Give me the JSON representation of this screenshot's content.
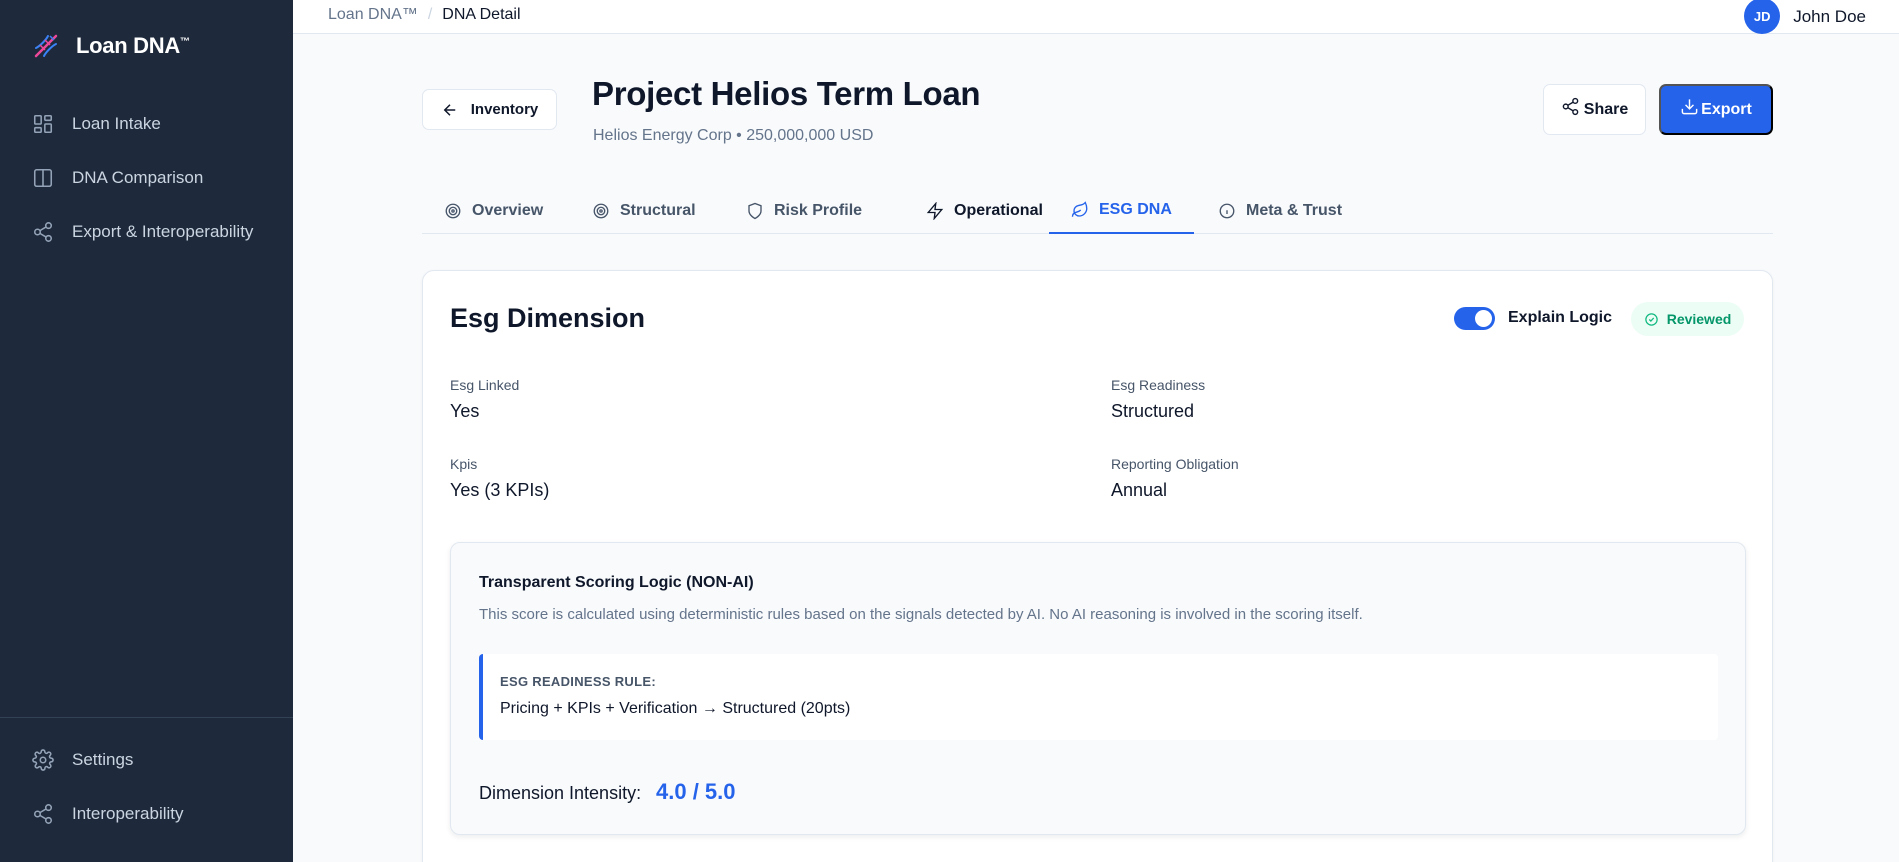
{
  "brand": {
    "name": "Loan DNA",
    "mark": "™"
  },
  "sidebar": {
    "items": [
      {
        "label": "Loan Intake",
        "icon": "grid-icon"
      },
      {
        "label": "DNA Comparison",
        "icon": "columns-icon"
      },
      {
        "label": "Export & Interoperability",
        "icon": "share-nodes-icon"
      }
    ],
    "bottom_items": [
      {
        "label": "Settings",
        "icon": "gear-icon"
      },
      {
        "label": "Interoperability",
        "icon": "share-nodes-icon"
      }
    ]
  },
  "topbar": {
    "breadcrumb": {
      "root": "Loan DNA™",
      "separator": "/",
      "current": "DNA Detail"
    },
    "user": {
      "initials": "JD",
      "name": "John Doe"
    }
  },
  "header": {
    "back_label": "Inventory",
    "title": "Project Helios Term Loan",
    "subtitle": "Helios Energy Corp • 250,000,000 USD",
    "share_label": "Share",
    "export_label": "Export"
  },
  "tabs": [
    {
      "label": "Overview",
      "icon": "target-icon"
    },
    {
      "label": "Structural",
      "icon": "target-icon"
    },
    {
      "label": "Risk Profile",
      "icon": "shield-icon"
    },
    {
      "label": "Operational",
      "icon": "lightning-icon"
    },
    {
      "label": "ESG DNA",
      "icon": "leaf-icon",
      "active": true
    },
    {
      "label": "Meta & Trust",
      "icon": "info-icon"
    }
  ],
  "card": {
    "title": "Esg Dimension",
    "explain_label": "Explain Logic",
    "explain_on": true,
    "status_badge": "Reviewed",
    "fields": [
      {
        "label": "Esg Linked",
        "value": "Yes"
      },
      {
        "label": "Esg Readiness",
        "value": "Structured"
      },
      {
        "label": "Kpis",
        "value": "Yes (3 KPIs)"
      },
      {
        "label": "Reporting Obligation",
        "value": "Annual"
      }
    ],
    "logic": {
      "title": "Transparent Scoring Logic (NON-AI)",
      "description": "This score is calculated using deterministic rules based on the signals detected by AI. No AI reasoning is involved in the scoring itself.",
      "rule_label": "ESG READINESS RULE:",
      "rule_text": "Pricing + KPIs + Verification → Structured (20pts)",
      "intensity_label": "Dimension Intensity:",
      "intensity_value": "4.0 / 5.0"
    }
  },
  "colors": {
    "accent": "#2563eb",
    "sidebar": "#1e293b",
    "success": "#059669"
  }
}
